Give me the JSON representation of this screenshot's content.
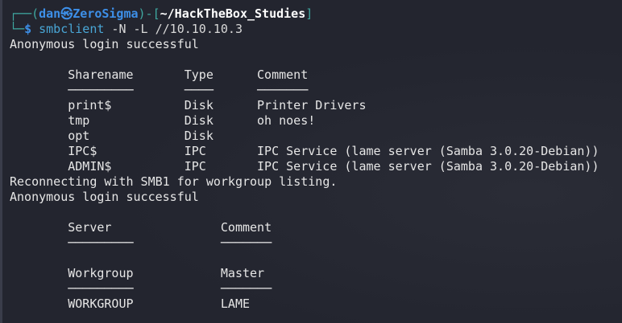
{
  "prompt": {
    "open": "┌──(",
    "user": "dan",
    "at": "㉿",
    "host": "ZeroSigma",
    "mid": ")-[",
    "path": "~/HackTheBox_Studies",
    "close": "]",
    "second": "└─",
    "dollar": "$ ",
    "command": "smbclient",
    "args": " -N -L //10.10.10.3"
  },
  "output": {
    "anon1": "Anonymous login successful",
    "shares": {
      "headers": [
        "Sharename",
        "Type",
        "Comment"
      ],
      "dashes": [
        "─────────",
        "────",
        "───────"
      ],
      "rows": [
        [
          "print$",
          "Disk",
          "Printer Drivers"
        ],
        [
          "tmp",
          "Disk",
          "oh noes!"
        ],
        [
          "opt",
          "Disk",
          ""
        ],
        [
          "IPC$",
          "IPC",
          "IPC Service (lame server (Samba 3.0.20-Debian))"
        ],
        [
          "ADMIN$",
          "IPC",
          "IPC Service (lame server (Samba 3.0.20-Debian))"
        ]
      ]
    },
    "reconnect": "Reconnecting with SMB1 for workgroup listing.",
    "anon2": "Anonymous login successful",
    "servers": {
      "headers": [
        "Server",
        "Comment"
      ],
      "dashes": [
        "─────────",
        "───────"
      ]
    },
    "workgroups": {
      "headers": [
        "Workgroup",
        "Master"
      ],
      "dashes": [
        "─────────",
        "───────"
      ],
      "rows": [
        [
          "WORKGROUP",
          "LAME"
        ]
      ]
    }
  }
}
